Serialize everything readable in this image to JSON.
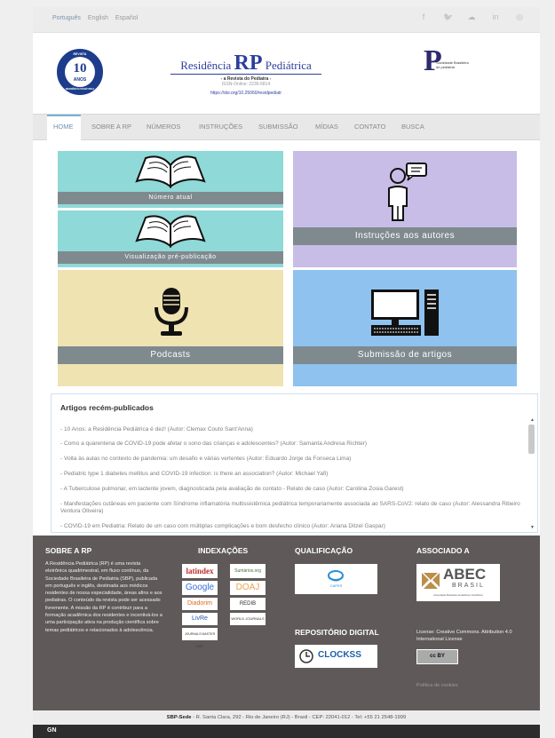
{
  "top_bar": {
    "languages": [
      "Português",
      "English",
      "Español"
    ],
    "social_icons": [
      "facebook-icon",
      "twitter-icon",
      "cloud-icon",
      "linkedin-icon",
      "instagram-icon"
    ],
    "social_glyphs": [
      "f",
      "🐦",
      "☁",
      "in",
      "◎"
    ]
  },
  "header": {
    "badge": {
      "top_text": "REVISTA",
      "number": "10",
      "label": "ANOS",
      "bottom_text": "RESIDÊNCIA PEDIÁTRICA"
    },
    "brand_left": "Residência",
    "brand_mid": "RP",
    "brand_right": "Pediátrica",
    "subtitle": "- a Revista do Pediatra -",
    "issn": "ISSN-Online: 2236-6814",
    "doi": "https://doi.org/10.25060/residpediatr",
    "sbp_letter": "P",
    "sbp_text": "Sociedade Brasileira de pediatria"
  },
  "nav": {
    "items": [
      "HOME",
      "SOBRE A RP",
      "NÚMEROS",
      "INSTRUÇÕES",
      "SUBMISSÃO",
      "MÍDIAS",
      "CONTATO",
      "BUSCA"
    ]
  },
  "tiles": {
    "current_issue": "Número atual",
    "preview": "Visualização pré-publicação",
    "instructions": "Instruções aos autores",
    "podcasts": "Podcasts",
    "submission": "Submissão de artigos"
  },
  "articles": {
    "heading": "Artigos recém-publicados",
    "items": [
      "- 10 Anos: a Residência Pediátrica é dez! (Autor: Clemax Couto Sant'Anna)",
      "- Como a quarentena de COVID-19 pode afetar o sono das crianças e adolescentes? (Autor: Samanta Andresa Richter)",
      "- Volta às aulas no contexto de pandemia: um desafio e várias vertentes (Autor: Eduardo Jorge da Fonseca Lima)",
      "- Pediatric type 1 diabetes mellitus and COVID-19 infection: is there an association? (Autor: Michael Yafi)",
      "- A Tuberculose pulmonar, em lactente jovem, diagnosticada pela avaliação de contato - Relato de caso (Autor: Carolina Zosia Garest)",
      "- Manifestações cutâneas em paciente com Síndrome inflamatória multissistêmica pediátrica temporariamente associada ao SARS-CoV2: relato de caso (Autor: Alessandra Ribeiro Ventura Oliveira)",
      "- COVID-19 em Pediatria: Relato de um caso com múltiplas complicações e bom desfecho clínico (Autor: Ariana Ditzel Gaspar)"
    ]
  },
  "footer": {
    "about_title": "SOBRE A RP",
    "about_text": "A Residência Pediátrica (RP) é uma revista eletrônica quadrimestral, em fluxo contínuo, da Sociedade Brasileira de Pediatria (SBP), publicada em português e inglês, destinada aos médicos residentes de nossa especialidade, áreas afins e aos pediatras. O conteúdo da revista pode ser acessado livremente. A missão da RP é contribuir para a formação acadêmica dos residentes e incentivá-los a uma participação ativa na produção científica sobre temas pediátricos e relacionados à adolescência.",
    "index_title": "INDEXAÇÕES",
    "index_logos": [
      "latindex",
      "Sumários.org",
      "Google",
      "DOAJ",
      "Diadorim",
      "REDIB",
      "LivRe",
      "WORLD JOURNALS",
      "JOURNALS MASTER LIST"
    ],
    "qualification_title": "QUALIFICAÇÃO",
    "capes": "CAPES",
    "repository_title": "REPOSITÓRIO DIGITAL",
    "clockss": "CLOCKSS",
    "associated_title": "ASSOCIADO A",
    "abec": "ABEC",
    "abec_sub": "BRASIL",
    "abec_desc": "Associação Brasileira de Editores Científicos",
    "license": "License: Creative Commons. Attribution 4.0 International License",
    "cc_badge": "cc  BY",
    "cookies": "Política de cookies"
  },
  "address": {
    "label": "SBP-Sede",
    "text": " - R. Santa Clara, 292 - Rio de Janeiro (RJ) - Brasil - CEP: 22041-012 - Tel: +55 21 2548-1999"
  },
  "bottom": {
    "logo": "GN"
  }
}
